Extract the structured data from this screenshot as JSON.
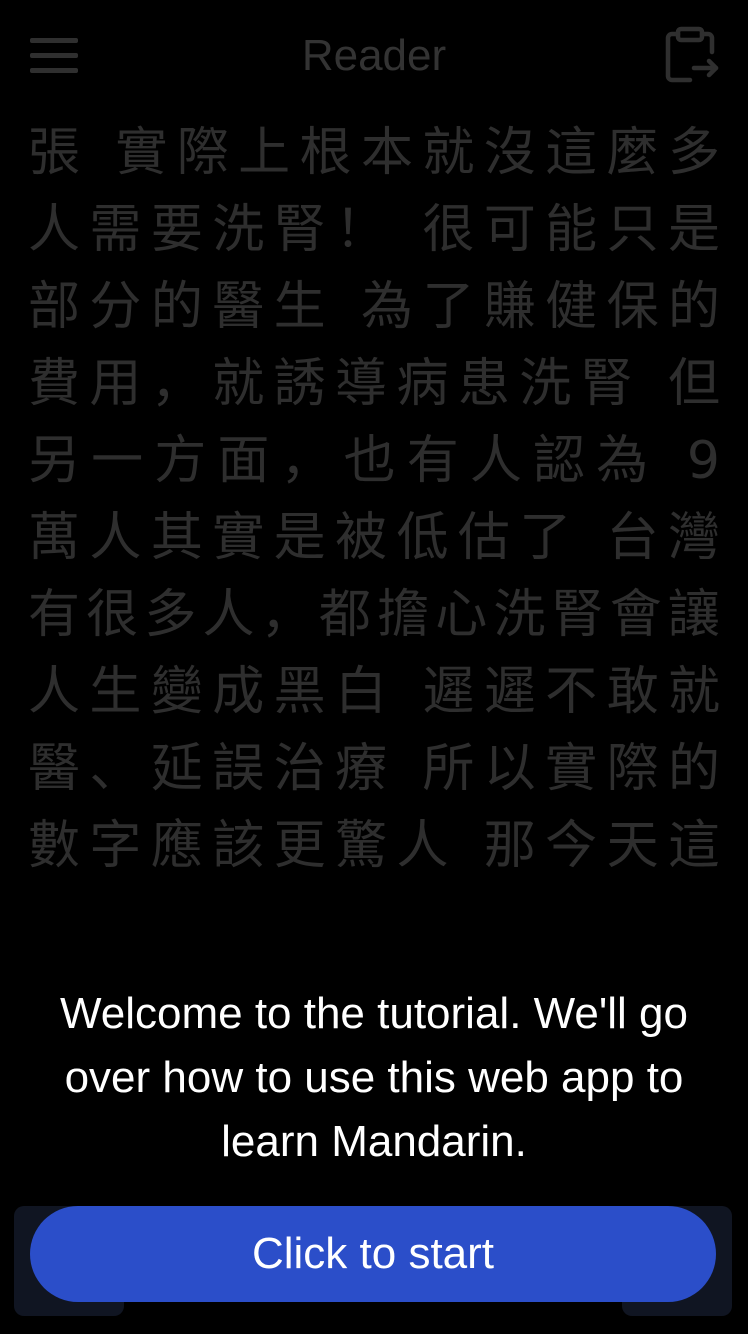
{
  "header": {
    "title": "Reader",
    "menu_icon": "menu-icon",
    "export_icon": "clipboard-export-icon"
  },
  "reader": {
    "lines": [
      "張　實際上根本就沒這麼多",
      "人需要洗腎！　很可能只是",
      "部分的醫生　為了賺健保的",
      "費用，就誘導病患洗腎　但",
      "另一方面，也有人認為　9",
      "萬人其實是被低估了　台灣",
      "有很多人，都擔心洗腎會讓",
      "人生變成黑白　遲遲不敢就",
      "醫、延誤治療　所以實際的",
      "數字應該更驚人　那今天這"
    ]
  },
  "tutorial": {
    "message": "Welcome to the tutorial. We'll go over how to use this web app to learn Mandarin.",
    "button_label": "Click to start"
  },
  "colors": {
    "background": "#000000",
    "dimmed_text": "#2e2e2e",
    "button": "#2b4ec9",
    "button_text": "#ffffff"
  }
}
